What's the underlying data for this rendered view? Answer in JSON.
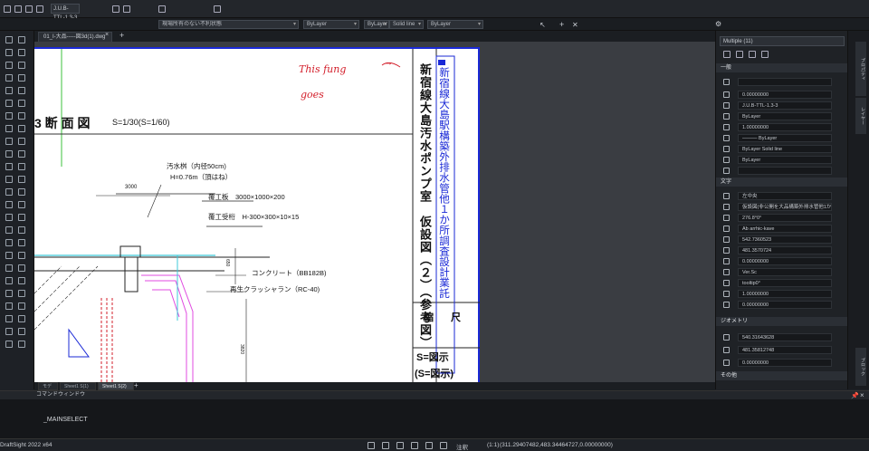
{
  "app": {
    "name": "DraftSight 2022 x64"
  },
  "toolbar": {
    "quick_access_icons": [
      "new-icon",
      "open-icon",
      "save-icon",
      "print-icon",
      "undo-icon",
      "redo-icon",
      "zoom-icon",
      "layer-icon"
    ],
    "layer_selector": "J.U.B-TTL-1.3-3",
    "layer_state": "現場所有のない不利状態"
  },
  "properties_bar": {
    "color": "ByLayer",
    "linetype_layer": "ByLayer",
    "linestyle": "Solid line",
    "lineweight": "ByLayer"
  },
  "tabs": [
    {
      "label": "01_I-大品-----図3d(1).dwg",
      "active": true
    }
  ],
  "tab_close": "×",
  "tab_add": "+",
  "drawing": {
    "annotation": {
      "line1": "This fung",
      "line2": "goes",
      "arrow": "→"
    },
    "section_title": "3 断 面 図",
    "section_scale": "S=1/30(S=1/60)",
    "dim_3000": "3000",
    "label_manhole_1": "汚水桝（内径50cm)",
    "label_manhole_2": "H=0.76m（頂はね）",
    "label_cover": "覆工板　3000×1000×200",
    "label_girder": "覆工受桁　H-300×300×10×15",
    "label_concrete": "コンクリート（BB182B)",
    "label_gravel": "再生クラッシャラン（RC-40)",
    "dim_650": "650",
    "dim_3820": "3820",
    "title_col1": "新宿線大島汚水ポンプ室　仮設図（２）（参考図）",
    "title_col2": "新宿線大島駅構築外排水管他１か所調査設計業託",
    "scale_header": "縮 尺",
    "scale_val1": "S=図示",
    "scale_val2": "(S=図示)"
  },
  "layout_tabs": [
    "モデル",
    "Sheet1 S(1)",
    "Sheet1 S(2)"
  ],
  "layout_add": "+",
  "right_panel": {
    "selector": "Multiple (11)",
    "section_general": "一般",
    "general_rows": [
      "",
      "0.00000000",
      "J.U.B-TTL-1.3-3",
      "ByLayer",
      "1.00000000",
      "——— ByLayer",
      "ByLayer     Solid line",
      "ByLayer",
      ""
    ],
    "section_text": "文字",
    "text_rows": [
      "左中央",
      "仮設図(非公開を大品構築外排水管他1か所調査設計業託",
      "276.8°0°",
      "Ab  arrhic-kave",
      "542.7360523",
      "481.3570724",
      "0.00000000",
      "Ver.Sc",
      "tooltip0°",
      "1.00000000",
      "0.00000000"
    ],
    "section_geometry": "ジオメトリ",
    "geometry_rows": [
      "540.31643628",
      "481.35812748",
      "0.00000000"
    ],
    "section_misc": "その他"
  },
  "side_tabs": [
    "プロパティ",
    "レイヤー",
    "ブロック"
  ],
  "command_window": {
    "title": "コマンドウィンドウ",
    "line": "_MAINSELECT"
  },
  "status_bar": {
    "app_label": "DraftSight 2022 x64",
    "annotation_label": "注釈",
    "scale": "(1:1)",
    "coords": "(311.29407482,483.34464727,0.00000000)"
  },
  "colors": {
    "accent_blue": "#1a29d6",
    "annot_red": "#d31f2b",
    "magenta": "#e04be0",
    "cyan": "#3cc8d8"
  }
}
